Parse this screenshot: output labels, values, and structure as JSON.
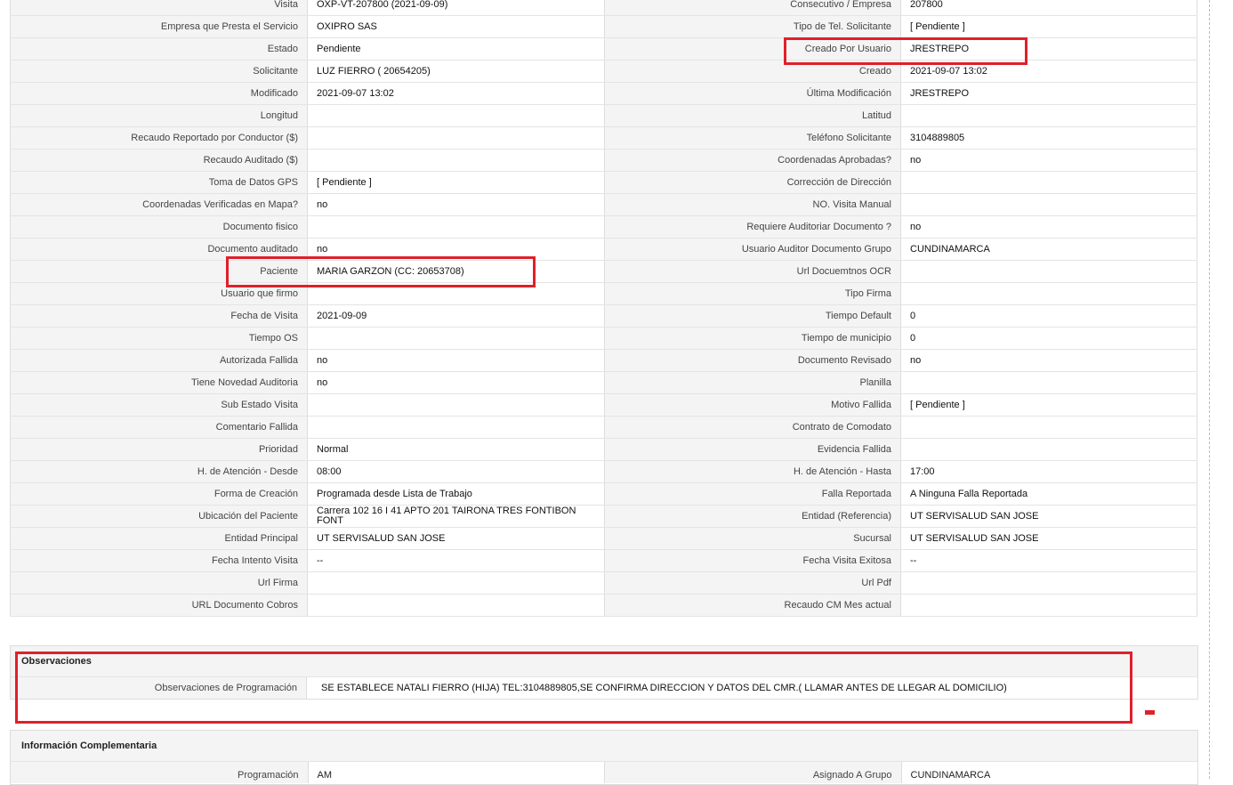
{
  "detail_rows": [
    {
      "l1": "Visita",
      "v1": "OXP-VT-207800 (2021-09-09)",
      "l2": "Consecutivo / Empresa",
      "v2": "207800"
    },
    {
      "l1": "Empresa que Presta el Servicio",
      "v1": "OXIPRO SAS",
      "l2": "Tipo de Tel. Solicitante",
      "v2": "[ Pendiente ]"
    },
    {
      "l1": "Estado",
      "v1": "Pendiente",
      "l2": "Creado Por Usuario",
      "v2": "JRESTREPO"
    },
    {
      "l1": "Solicitante",
      "v1": "LUZ FIERRO ( 20654205)",
      "l2": "Creado",
      "v2": "2021-09-07 13:02"
    },
    {
      "l1": "Modificado",
      "v1": "2021-09-07 13:02",
      "l2": "Última Modificación",
      "v2": " JRESTREPO"
    },
    {
      "l1": "Longitud",
      "v1": "",
      "l2": "Latitud",
      "v2": ""
    },
    {
      "l1": "Recaudo Reportado por Conductor ($)",
      "v1": "",
      "l2": "Teléfono Solicitante",
      "v2": "3104889805"
    },
    {
      "l1": "Recaudo Auditado ($)",
      "v1": "",
      "l2": "Coordenadas Aprobadas?",
      "v2": " no"
    },
    {
      "l1": "Toma de Datos GPS",
      "v1": "[ Pendiente ]",
      "l2": "Corrección de Dirección",
      "v2": ""
    },
    {
      "l1": "Coordenadas Verificadas en Mapa?",
      "v1": " no",
      "l2": "NO. Visita Manual",
      "v2": ""
    },
    {
      "l1": "Documento fisico",
      "v1": "",
      "l2": "Requiere Auditoriar Documento ?",
      "v2": " no"
    },
    {
      "l1": "Documento auditado",
      "v1": " no",
      "l2": "Usuario Auditor Documento Grupo",
      "v2": "CUNDINAMARCA"
    },
    {
      "l1": "Paciente",
      "v1": "MARIA GARZON (CC: 20653708)",
      "l2": "Url Docuemtnos OCR",
      "v2": ""
    },
    {
      "l1": "Usuario que firmo",
      "v1": "",
      "l2": "Tipo Firma",
      "v2": ""
    },
    {
      "l1": "Fecha de Visita",
      "v1": " 2021-09-09",
      "l2": "Tiempo Default",
      "v2": "0"
    },
    {
      "l1": "Tiempo OS",
      "v1": "",
      "l2": "Tiempo de municipio",
      "v2": "0"
    },
    {
      "l1": "Autorizada Fallida",
      "v1": " no",
      "l2": "Documento Revisado",
      "v2": " no"
    },
    {
      "l1": "Tiene Novedad Auditoria",
      "v1": " no",
      "l2": "Planilla",
      "v2": ""
    },
    {
      "l1": "Sub Estado Visita",
      "v1": "",
      "l2": "Motivo Fallida",
      "v2": "[ Pendiente ]"
    },
    {
      "l1": "Comentario Fallida",
      "v1": "",
      "l2": "Contrato de Comodato",
      "v2": ""
    },
    {
      "l1": "Prioridad",
      "v1": "Normal",
      "l2": "Evidencia Fallida",
      "v2": ""
    },
    {
      "l1": "H. de Atención - Desde",
      "v1": "08:00",
      "l2": "H. de Atención - Hasta",
      "v2": "17:00"
    },
    {
      "l1": "Forma de Creación",
      "v1": "Programada desde Lista de Trabajo",
      "l2": "Falla Reportada",
      "v2": "A Ninguna Falla Reportada"
    },
    {
      "l1": "Ubicación del Paciente",
      "v1": "Carrera 102 16 I 41 APTO 201 TAIRONA TRES FONTIBON FONT",
      "l2": "Entidad (Referencia)",
      "v2": "UT SERVISALUD SAN JOSE"
    },
    {
      "l1": "Entidad Principal",
      "v1": "UT SERVISALUD SAN JOSE",
      "l2": "Sucursal",
      "v2": "UT SERVISALUD SAN JOSE"
    },
    {
      "l1": "Fecha Intento Visita",
      "v1": " --",
      "l2": "Fecha Visita Exitosa",
      "v2": " --"
    },
    {
      "l1": "Url Firma",
      "v1": "",
      "l2": "Url Pdf",
      "v2": ""
    },
    {
      "l1": "URL Documento Cobros",
      "v1": "",
      "l2": "Recaudo CM Mes actual",
      "v2": ""
    }
  ],
  "observaciones": {
    "title": "Observaciones",
    "label": "Observaciones de Programación",
    "value": "SE ESTABLECE NATALI FIERRO (HIJA) TEL:3104889805,SE CONFIRMA DIRECCION Y DATOS DEL CMR.( LLAMAR ANTES DE LLEGAR AL DOMICILIO)"
  },
  "complementaria": {
    "title": "Información Complementaria",
    "l1": "Programación",
    "v1": "AM",
    "l2": "Asignado A Grupo",
    "v2": "CUNDINAMARCA"
  },
  "colors": {
    "highlight": "#e0202a",
    "label_bg": "#f4f4f4",
    "border": "#dddddd"
  }
}
